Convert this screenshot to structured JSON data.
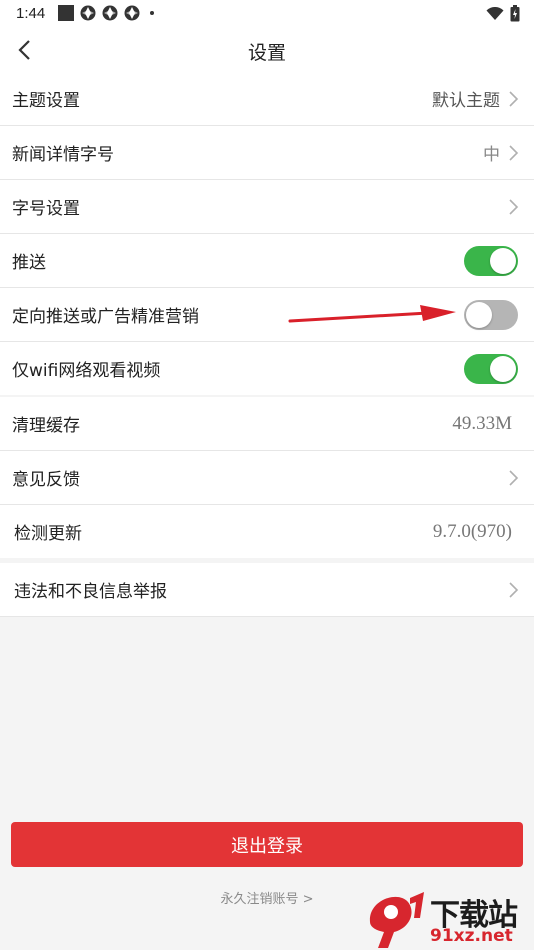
{
  "status_bar": {
    "time": "1:44",
    "icons": [
      "square-icon",
      "aperture-icon",
      "aperture-icon",
      "aperture-icon",
      "dot-icon"
    ],
    "right_icons": [
      "wifi-icon",
      "battery-icon"
    ]
  },
  "nav": {
    "title": "设置"
  },
  "group1": {
    "theme": {
      "label": "主题设置",
      "value": "默认主题"
    },
    "news_font": {
      "label": "新闻详情字号",
      "value": "中"
    },
    "font_setting": {
      "label": "字号设置"
    },
    "push": {
      "label": "推送",
      "enabled": true
    },
    "targeted_push": {
      "label": "定向推送或广告精准营销",
      "enabled": false
    },
    "wifi_video": {
      "label": "仅wifi网络观看视频",
      "enabled": true
    }
  },
  "group2": {
    "clear_cache": {
      "label": "清理缓存",
      "value": "49.33M"
    },
    "feedback": {
      "label": "意见反馈"
    },
    "check_update": {
      "label": "检测更新",
      "value": "9.7.0(970)"
    }
  },
  "group3": {
    "report": {
      "label": "违法和不良信息举报"
    }
  },
  "footer": {
    "logout_label": "退出登录",
    "cancel_account": "永久注销账号 >"
  },
  "watermark": {
    "text_main": "下载站",
    "text_domain": "91xz.net"
  },
  "colors": {
    "toggle_on": "#3ab54a",
    "toggle_off": "#b5b5b5",
    "logout_bg": "#e33436",
    "annotation_arrow": "#d9202a"
  }
}
